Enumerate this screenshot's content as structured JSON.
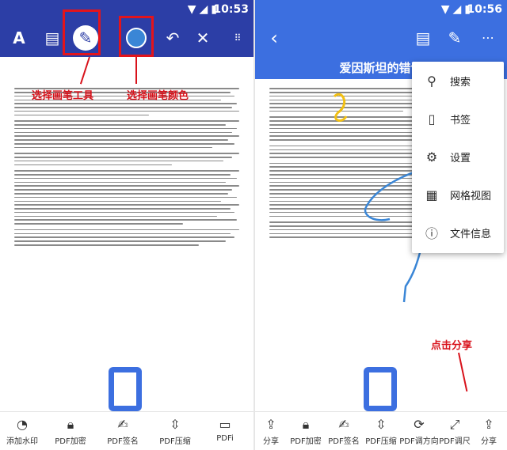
{
  "left": {
    "status": {
      "time": "10:53"
    },
    "toolbar": {
      "text_tool_icon": "letter-a-icon",
      "note_tool_icon": "note-icon",
      "pen_tool_icon": "pen-circle-icon",
      "color_tool_icon": "color-dot-icon",
      "undo_icon": "undo-icon",
      "close_icon": "close-icon",
      "more_icon": "drag-dots-icon"
    },
    "annotations": {
      "select_pen_tool": "选择画笔工具",
      "select_pen_color": "选择画笔颜色"
    },
    "bottom_bar": [
      {
        "label": "添加水印",
        "icon": "watermark-icon"
      },
      {
        "label": "PDF加密",
        "icon": "lock-icon"
      },
      {
        "label": "PDF签名",
        "icon": "signature-icon"
      },
      {
        "label": "PDF压缩",
        "icon": "compress-icon"
      },
      {
        "label": "PDFi",
        "icon": "pdf-icon"
      }
    ]
  },
  "right": {
    "status": {
      "time": "10:56"
    },
    "toolbar": {
      "back_icon": "chevron-left-icon",
      "edit_icon": "edit-note-icon",
      "pen_icon": "pen-icon",
      "more_icon": "more-horizontal-icon"
    },
    "doc_title": "爱因斯坦的错误",
    "menu": [
      {
        "label": "搜索",
        "icon": "search-icon"
      },
      {
        "label": "书签",
        "icon": "bookmark-icon"
      },
      {
        "label": "设置",
        "icon": "gear-icon"
      },
      {
        "label": "网格视图",
        "icon": "grid-icon"
      },
      {
        "label": "文件信息",
        "icon": "info-icon"
      }
    ],
    "annotations": {
      "click_share": "点击分享"
    },
    "bottom_bar": [
      {
        "label": "分享",
        "icon": "share-icon"
      },
      {
        "label": "PDF加密",
        "icon": "lock-icon"
      },
      {
        "label": "PDF签名",
        "icon": "signature-icon"
      },
      {
        "label": "PDF压缩",
        "icon": "compress-icon"
      },
      {
        "label": "PDF调方向",
        "icon": "rotate-icon"
      },
      {
        "label": "PDF调尺",
        "icon": "resize-icon"
      },
      {
        "label": "分享",
        "icon": "share-icon"
      }
    ]
  },
  "colors": {
    "left_bar": "#2c3ea6",
    "right_bar": "#3c6fe0",
    "annotation_red": "#d8121b",
    "pen_color": "#3a86d6"
  }
}
